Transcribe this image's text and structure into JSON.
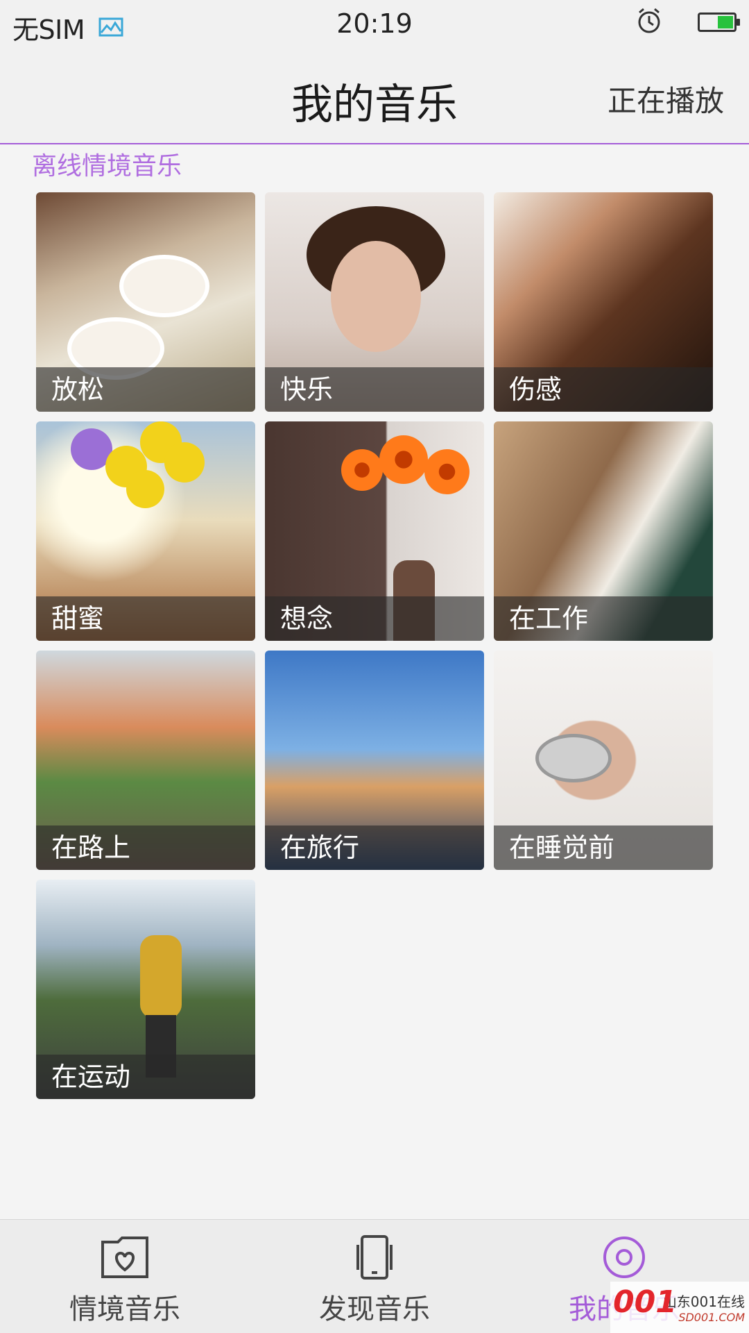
{
  "status_bar": {
    "carrier": "无SIM",
    "time": "20:19",
    "icons": [
      "gallery-icon",
      "alarm-icon",
      "battery-icon"
    ]
  },
  "header": {
    "title": "我的音乐",
    "now_playing": "正在播放"
  },
  "section": {
    "label": "离线情境音乐"
  },
  "tiles": [
    {
      "label": "放松"
    },
    {
      "label": "快乐"
    },
    {
      "label": "伤感"
    },
    {
      "label": "甜蜜"
    },
    {
      "label": "想念"
    },
    {
      "label": "在工作"
    },
    {
      "label": "在路上"
    },
    {
      "label": "在旅行"
    },
    {
      "label": "在睡觉前"
    },
    {
      "label": "在运动"
    }
  ],
  "bottom_nav": {
    "items": [
      {
        "label": "情境音乐",
        "icon": "folder-heart-icon"
      },
      {
        "label": "发现音乐",
        "icon": "phone-icon"
      },
      {
        "label": "我的音乐",
        "icon": "disc-icon",
        "active": true
      }
    ]
  },
  "watermark": {
    "brand": "山东001在线",
    "domain": "SD001.COM",
    "logo": "001"
  },
  "colors": {
    "accent": "#a45bd8",
    "section_label": "#b06ee0",
    "battery": "#27c23c"
  }
}
